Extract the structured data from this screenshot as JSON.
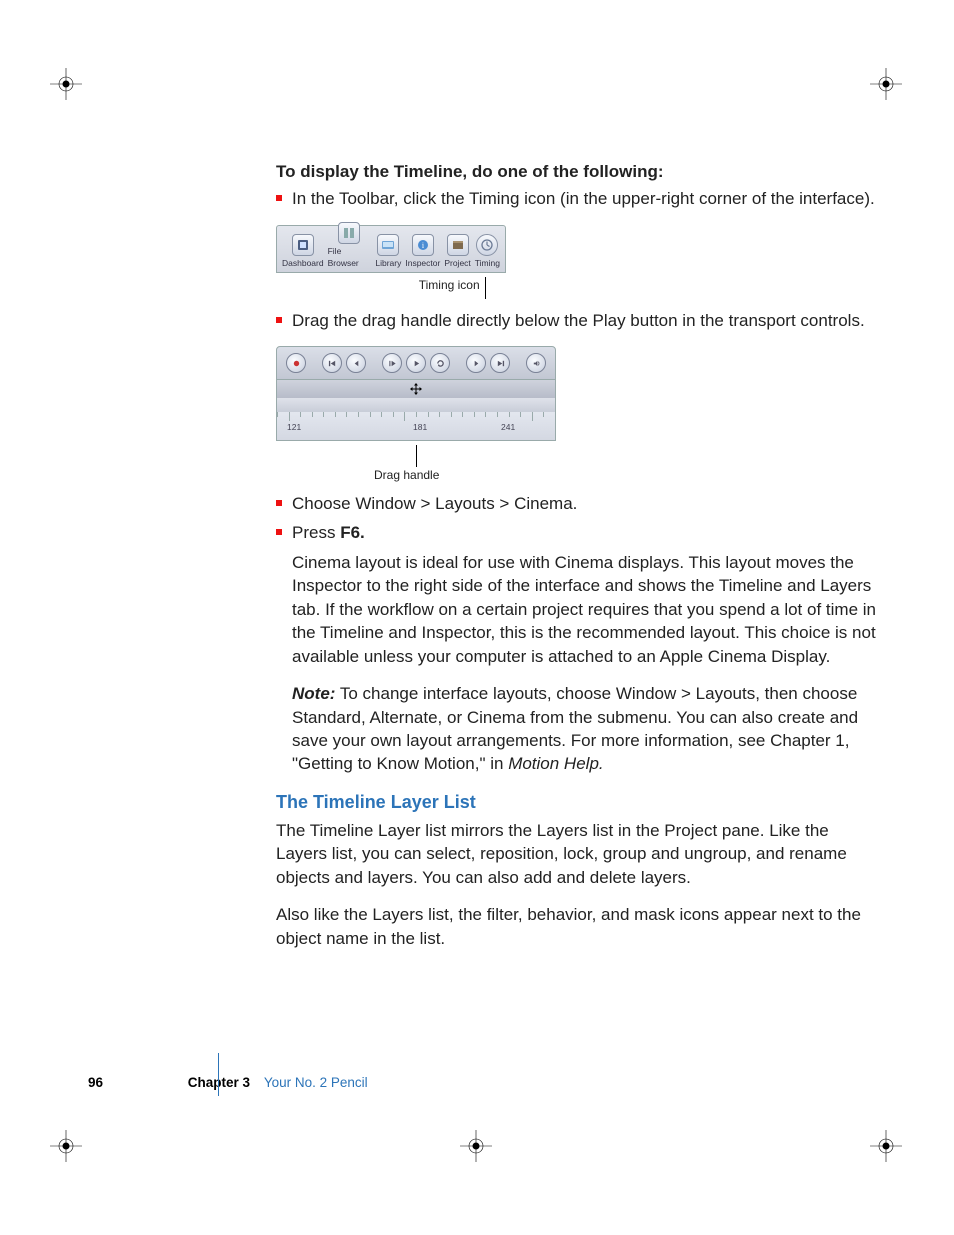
{
  "heading": "To display the Timeline, do one of the following:",
  "bullets": {
    "b1": "In the Toolbar, click the Timing icon (in the upper-right corner of the interface).",
    "b2": "Drag the drag handle directly below the Play button in the transport controls.",
    "b3": "Choose Window > Layouts > Cinema.",
    "b4_pre": "Press ",
    "b4_key": "F6."
  },
  "fig1": {
    "items": [
      "Dashboard",
      "File Browser",
      "Library",
      "Inspector",
      "Project",
      "Timing"
    ],
    "callout": "Timing icon"
  },
  "fig2": {
    "callout": "Drag handle",
    "ruler_labels": [
      "121",
      "181",
      "241"
    ]
  },
  "cinema_para": "Cinema layout is ideal for use with Cinema displays. This layout moves the Inspector to the right side of the interface and shows the Timeline and Layers tab. If the workflow on a certain project requires that you spend a lot of time in the Timeline and Inspector, this is the recommended layout. This choice is not available unless your computer is attached to an Apple Cinema Display.",
  "note_label": "Note:",
  "note_text": "  To change interface layouts, choose Window > Layouts, then choose Standard, Alternate, or Cinema from the submenu. You can also create and save your own layout arrangements. For more information, see Chapter 1, \"Getting to Know Motion,\" in ",
  "note_ref": "Motion Help.",
  "section_title": "The Timeline Layer List",
  "section_p1": "The Timeline Layer list mirrors the Layers list in the Project pane. Like the Layers list, you can select, reposition, lock, group and ungroup, and rename objects and layers. You can also add and delete layers.",
  "section_p2": "Also like the Layers list, the filter, behavior, and mask icons appear next to the object name in the list.",
  "footer": {
    "page": "96",
    "chapter_label": "Chapter 3",
    "chapter_title": "Your No. 2 Pencil"
  }
}
